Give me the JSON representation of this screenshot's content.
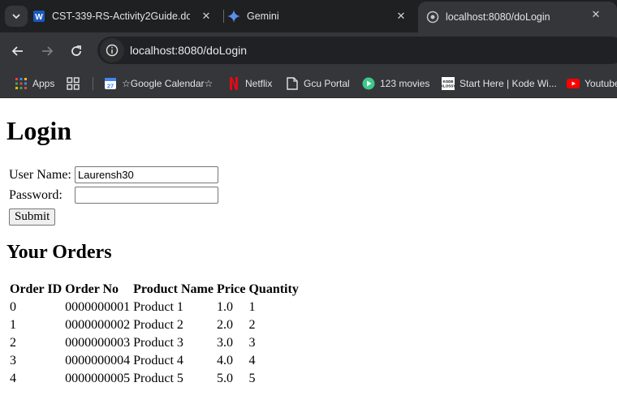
{
  "tabs": [
    {
      "title": "CST-339-RS-Activity2Guide.doc",
      "icon": "word-icon"
    },
    {
      "title": "Gemini",
      "icon": "gemini-icon"
    },
    {
      "title": "localhost:8080/doLogin",
      "icon": "globe-icon",
      "active": true
    }
  ],
  "address_bar": {
    "url": "localhost:8080/doLogin"
  },
  "bookmarks": [
    {
      "label": "Apps",
      "icon": "apps-grid-icon"
    },
    {
      "label": "",
      "icon": "tab-groups-icon"
    },
    {
      "label": "☆Google Calendar☆",
      "icon": "calendar-icon"
    },
    {
      "label": "Netflix",
      "icon": "netflix-icon"
    },
    {
      "label": "Gcu Portal",
      "icon": "page-icon"
    },
    {
      "label": "123 movies",
      "icon": "play-icon"
    },
    {
      "label": "Start Here | Kode Wi...",
      "icon": "kode-icon"
    },
    {
      "label": "Youtube",
      "icon": "youtube-icon"
    }
  ],
  "page": {
    "title": "Login",
    "form": {
      "username_label": "User Name:",
      "username_value": "Laurensh30",
      "password_label": "Password:",
      "password_value": "",
      "submit_label": "Submit"
    },
    "orders_title": "Your Orders",
    "orders_table": {
      "headers": [
        "Order ID",
        "Order No",
        "Product Name",
        "Price",
        "Quantity"
      ],
      "rows": [
        [
          "0",
          "0000000001",
          "Product 1",
          "1.0",
          "1"
        ],
        [
          "1",
          "0000000002",
          "Product 2",
          "2.0",
          "2"
        ],
        [
          "2",
          "0000000003",
          "Product 3",
          "3.0",
          "3"
        ],
        [
          "3",
          "0000000004",
          "Product 4",
          "4.0",
          "4"
        ],
        [
          "4",
          "0000000005",
          "Product 5",
          "5.0",
          "5"
        ]
      ]
    }
  }
}
